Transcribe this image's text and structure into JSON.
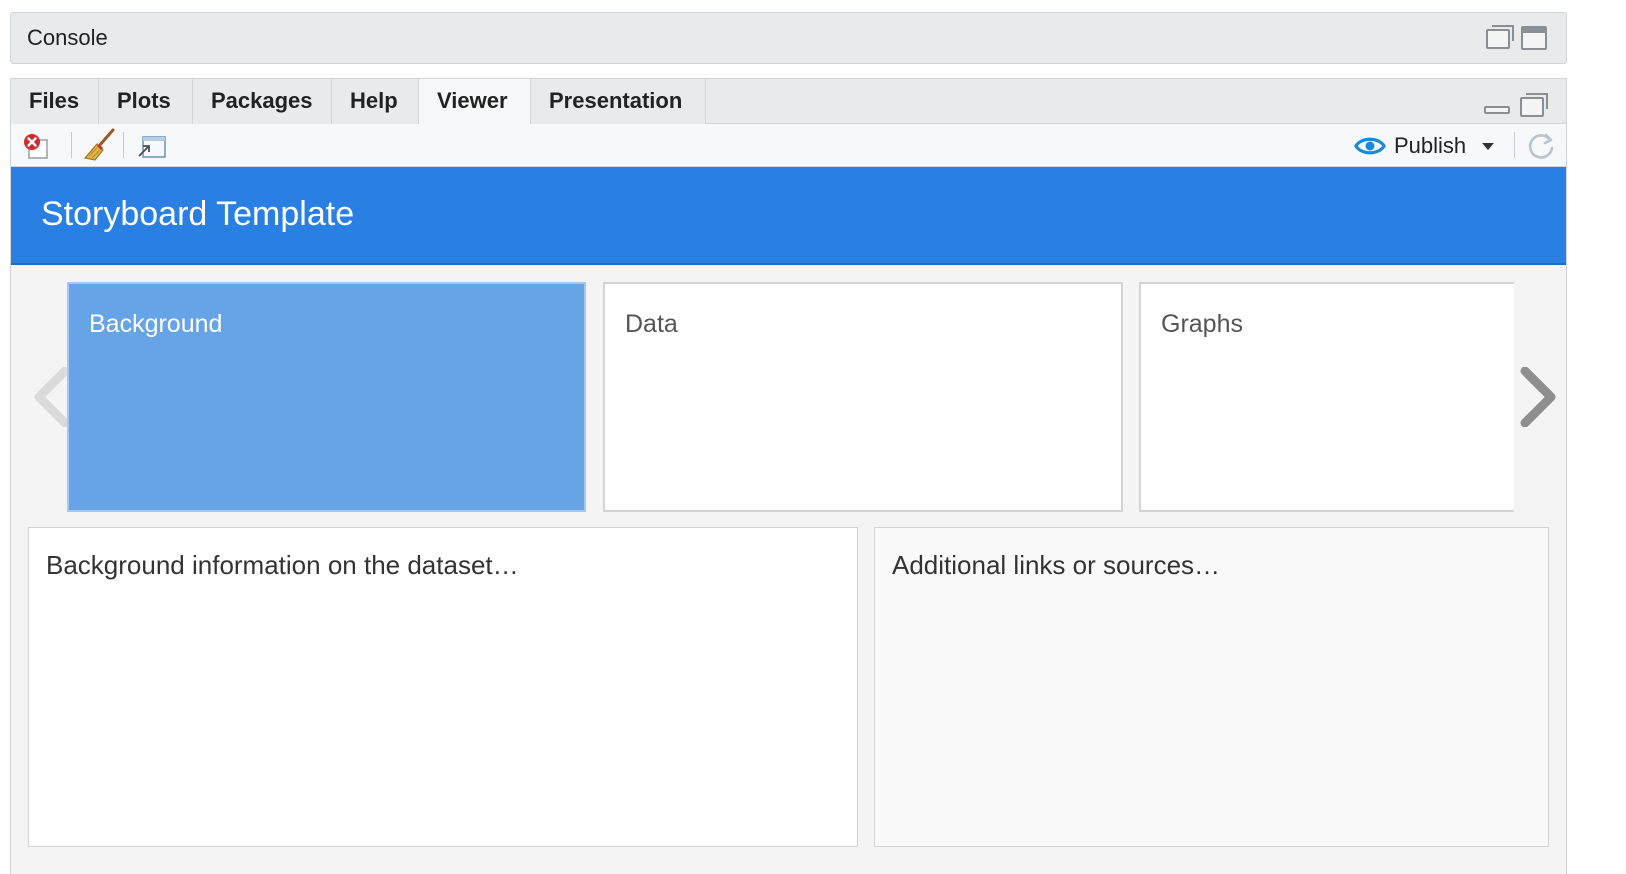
{
  "console": {
    "title": "Console"
  },
  "tabs": [
    {
      "label": "Files",
      "active": false
    },
    {
      "label": "Plots",
      "active": false
    },
    {
      "label": "Packages",
      "active": false
    },
    {
      "label": "Help",
      "active": false
    },
    {
      "label": "Viewer",
      "active": true
    },
    {
      "label": "Presentation",
      "active": false
    }
  ],
  "toolbar": {
    "icons": [
      "clear-viewer-icon",
      "broom-icon",
      "export-icon",
      "refresh-icon"
    ],
    "publish_label": "Publish"
  },
  "storyboard": {
    "title": "Storyboard Template",
    "cards": [
      {
        "label": "Background",
        "active": true
      },
      {
        "label": "Data",
        "active": false
      },
      {
        "label": "Graphs",
        "active": false
      }
    ],
    "panels": {
      "main": "Background information on the dataset…",
      "side": "Additional links or sources…"
    }
  },
  "colors": {
    "header_blue": "#2a7fe3",
    "active_card": "#66a4e7",
    "publish_icon": "#1a8ad6",
    "close_red": "#d02a2a"
  }
}
